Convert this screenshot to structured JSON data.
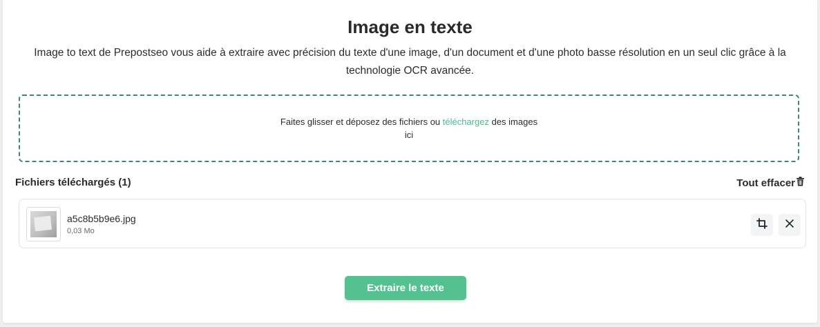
{
  "header": {
    "title": "Image en texte",
    "description": "Image to text de Prepostseo vous aide à extraire avec précision du texte d'une image, d'un document et d'une photo basse résolution en un seul clic grâce à la technologie OCR avancée."
  },
  "dropzone": {
    "text_before": "Faites glisser et déposez des fichiers ou ",
    "link_label": "téléchargez",
    "text_after": " des images ici"
  },
  "files": {
    "heading": "Fichiers téléchargés (1)",
    "clear_all_label": "Tout effacer",
    "items": [
      {
        "name": "a5c8b5b9e6.jpg",
        "size": "0,03 Mo"
      }
    ]
  },
  "actions": {
    "extract_label": "Extraire le texte"
  },
  "colors": {
    "accent": "#54c191",
    "link": "#4cbb8a",
    "dropzone_border": "#3b8a63"
  },
  "icons": {
    "clear_all": "trash-icon",
    "crop": "crop-icon",
    "remove": "close-icon"
  }
}
